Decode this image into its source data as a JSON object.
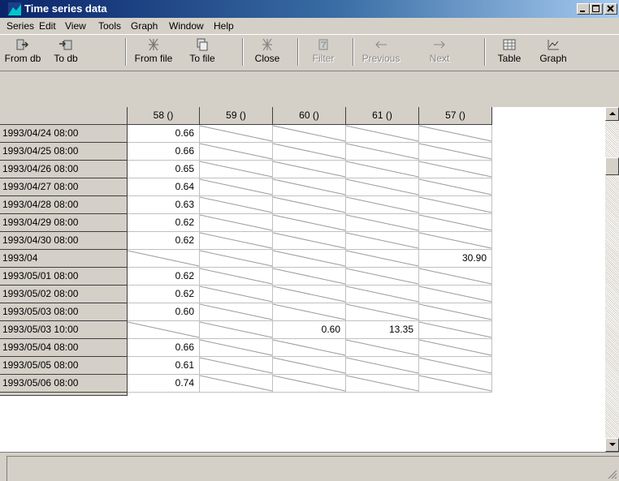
{
  "window": {
    "title": "Time series data",
    "controls": [
      "minimize",
      "maximize",
      "close"
    ]
  },
  "menu": [
    "Series",
    "Edit",
    "View",
    "Tools",
    "Graph",
    "Window",
    "Help"
  ],
  "toolbar": [
    {
      "label": "From db",
      "icon": "import-from-db-icon",
      "enabled": true
    },
    {
      "label": "To db",
      "icon": "export-to-db-icon",
      "enabled": true
    },
    {
      "label": "From file",
      "icon": "open-file-icon",
      "enabled": true
    },
    {
      "label": "To file",
      "icon": "save-file-icon",
      "enabled": true
    },
    {
      "label": "Close",
      "icon": "close-series-icon",
      "enabled": true
    },
    {
      "label": "Filter",
      "icon": "filter-icon",
      "enabled": false
    },
    {
      "label": "Previous",
      "icon": "arrow-left-icon",
      "enabled": false
    },
    {
      "label": "Next",
      "icon": "arrow-right-icon",
      "enabled": false
    },
    {
      "label": "Table",
      "icon": "table-icon",
      "enabled": true
    },
    {
      "label": "Graph",
      "icon": "graph-icon",
      "enabled": true
    }
  ],
  "grid": {
    "columns": [
      "58 ()",
      "59 ()",
      "60 ()",
      "61 ()",
      "57 ()"
    ],
    "rows": [
      {
        "label": "1993/04/24 08:00",
        "values": [
          "0.66",
          "",
          "",
          "",
          ""
        ]
      },
      {
        "label": "1993/04/25 08:00",
        "values": [
          "0.66",
          "",
          "",
          "",
          ""
        ]
      },
      {
        "label": "1993/04/26 08:00",
        "values": [
          "0.65",
          "",
          "",
          "",
          ""
        ]
      },
      {
        "label": "1993/04/27 08:00",
        "values": [
          "0.64",
          "",
          "",
          "",
          ""
        ]
      },
      {
        "label": "1993/04/28 08:00",
        "values": [
          "0.63",
          "",
          "",
          "",
          ""
        ]
      },
      {
        "label": "1993/04/29 08:00",
        "values": [
          "0.62",
          "",
          "",
          "",
          ""
        ]
      },
      {
        "label": "1993/04/30 08:00",
        "values": [
          "0.62",
          "",
          "",
          "",
          ""
        ]
      },
      {
        "label": "1993/04",
        "values": [
          "",
          "",
          "",
          "",
          "30.90"
        ]
      },
      {
        "label": "1993/05/01 08:00",
        "values": [
          "0.62",
          "",
          "",
          "",
          ""
        ]
      },
      {
        "label": "1993/05/02 08:00",
        "values": [
          "0.62",
          "",
          "",
          "",
          ""
        ]
      },
      {
        "label": "1993/05/03 08:00",
        "values": [
          "0.60",
          "",
          "",
          "",
          ""
        ]
      },
      {
        "label": "1993/05/03 10:00",
        "values": [
          "",
          "",
          "0.60",
          "13.35",
          ""
        ]
      },
      {
        "label": "1993/05/04 08:00",
        "values": [
          "0.66",
          "",
          "",
          "",
          ""
        ]
      },
      {
        "label": "1993/05/05 08:00",
        "values": [
          "0.61",
          "",
          "",
          "",
          ""
        ]
      },
      {
        "label": "1993/05/06 08:00",
        "values": [
          "0.74",
          "",
          "",
          "",
          ""
        ]
      }
    ]
  },
  "colors": {
    "title_gradient_start": "#0a246a",
    "title_gradient_end": "#a6caf0",
    "face": "#d4d0c8",
    "grid_background": "#ffffff"
  }
}
